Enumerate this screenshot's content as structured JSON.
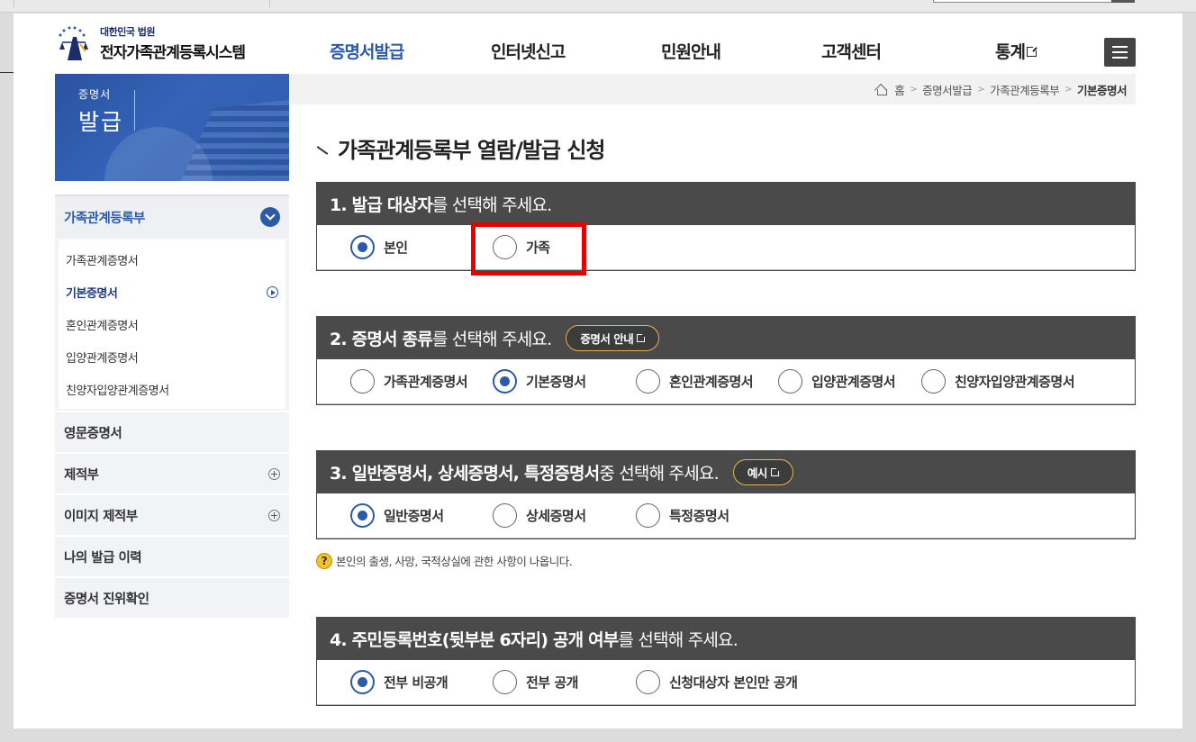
{
  "header": {
    "logo_small": "대한민국 법원",
    "logo_big": "전자가족관계등록시스템",
    "nav": [
      {
        "label": "증명서발급",
        "active": true
      },
      {
        "label": "인터넷신고"
      },
      {
        "label": "민원안내"
      },
      {
        "label": "고객센터"
      },
      {
        "label": "통계",
        "external": true
      }
    ]
  },
  "banner": {
    "line1": "증명서",
    "line2": "발급"
  },
  "sidebar": {
    "head": "가족관계등록부",
    "sub_items": [
      {
        "label": "가족관계증명서"
      },
      {
        "label": "기본증명서",
        "active": true
      },
      {
        "label": "혼인관계증명서"
      },
      {
        "label": "입양관계증명서"
      },
      {
        "label": "친양자입양관계증명서"
      }
    ],
    "items": [
      {
        "label": "영문증명서"
      },
      {
        "label": "제적부",
        "expandable": true
      },
      {
        "label": "이미지 제적부",
        "expandable": true
      },
      {
        "label": "나의 발급 이력"
      },
      {
        "label": "증명서 진위확인"
      }
    ]
  },
  "breadcrumb": [
    "홈",
    "증명서발급",
    "가족관계등록부",
    "기본증명서"
  ],
  "page_title": "가족관계등록부 열람/발급 신청",
  "sections": [
    {
      "head_bold": "1. 발급 대상자",
      "head_rest": "를 선택해 주세요.",
      "options": [
        {
          "label": "본인",
          "checked": true
        },
        {
          "label": "가족",
          "checked": false
        }
      ]
    },
    {
      "head_bold": "2. 증명서 종류",
      "head_rest": "를 선택해 주세요.",
      "button": "증명서 안내",
      "options": [
        {
          "label": "가족관계증명서",
          "checked": false
        },
        {
          "label": "기본증명서",
          "checked": true
        },
        {
          "label": "혼인관계증명서",
          "checked": false
        },
        {
          "label": "입양관계증명서",
          "checked": false
        },
        {
          "label": "친양자입양관계증명서",
          "checked": false
        }
      ]
    },
    {
      "head_bold": "3. 일반증명서, 상세증명서, 특정증명서",
      "head_rest": " 중 선택해 주세요.",
      "button": "예시",
      "options": [
        {
          "label": "일반증명서",
          "checked": true
        },
        {
          "label": "상세증명서",
          "checked": false
        },
        {
          "label": "특정증명서",
          "checked": false
        }
      ],
      "note": "본인의 출생, 사망, 국적상실에 관한 사항이 나옵니다."
    },
    {
      "head_bold": "4. 주민등록번호(뒷부분 6자리) 공개 여부",
      "head_rest": "를 선택해 주세요.",
      "options": [
        {
          "label": "전부 비공개",
          "checked": true
        },
        {
          "label": "전부 공개",
          "checked": false
        },
        {
          "label": "신청대상자 본인만 공개",
          "checked": false
        }
      ]
    }
  ],
  "colors": {
    "accent": "#2b5aa8",
    "section_header": "#4a4a4a",
    "highlight": "#e60000",
    "pill_border": "#e3b54a"
  }
}
